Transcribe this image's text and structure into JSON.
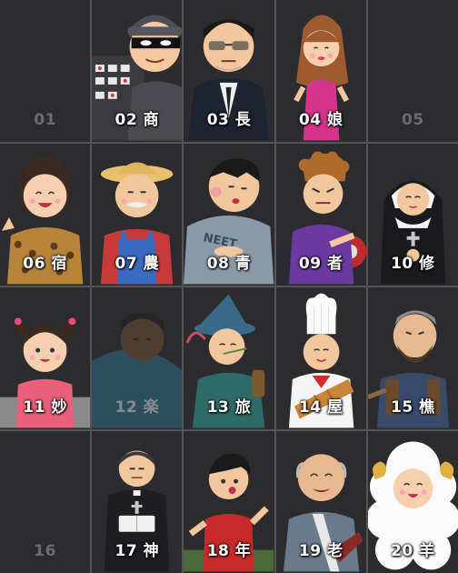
{
  "cards": [
    {
      "label": "01",
      "state": "locked",
      "icon": "empty-slot"
    },
    {
      "label": "02 商",
      "state": "unlocked",
      "icon": "thief-icon"
    },
    {
      "label": "03 長",
      "state": "unlocked",
      "icon": "boss-icon"
    },
    {
      "label": "04 娘",
      "state": "unlocked",
      "icon": "woman-icon"
    },
    {
      "label": "05",
      "state": "locked",
      "icon": "empty-slot"
    },
    {
      "label": "06 宿",
      "state": "unlocked",
      "icon": "leopard-lady-icon"
    },
    {
      "label": "07 農",
      "state": "unlocked",
      "icon": "farmer-icon"
    },
    {
      "label": "08 青",
      "state": "unlocked",
      "icon": "neet-icon"
    },
    {
      "label": "09 者",
      "state": "unlocked",
      "icon": "biker-icon"
    },
    {
      "label": "10 修",
      "state": "unlocked",
      "icon": "nun-icon"
    },
    {
      "label": "11 妙",
      "state": "unlocked",
      "icon": "girl-icon"
    },
    {
      "label": "12 楽",
      "state": "dimmed",
      "icon": "sleeper-icon"
    },
    {
      "label": "13 旅",
      "state": "unlocked",
      "icon": "traveler-icon"
    },
    {
      "label": "14 屋",
      "state": "unlocked",
      "icon": "baker-icon"
    },
    {
      "label": "15 樵",
      "state": "unlocked",
      "icon": "woodcutter-icon"
    },
    {
      "label": "16",
      "state": "locked",
      "icon": "empty-slot"
    },
    {
      "label": "17 神",
      "state": "unlocked",
      "icon": "priest-icon"
    },
    {
      "label": "18 年",
      "state": "unlocked",
      "icon": "runner-icon"
    },
    {
      "label": "19 老",
      "state": "unlocked",
      "icon": "old-man-icon"
    },
    {
      "label": "20 羊",
      "state": "unlocked",
      "icon": "sheep-costume-icon"
    }
  ],
  "colors": {
    "background": "#2c2c2e",
    "grid_line": "#555558",
    "label": "#ffffff",
    "locked_label": "#6b6b70"
  }
}
